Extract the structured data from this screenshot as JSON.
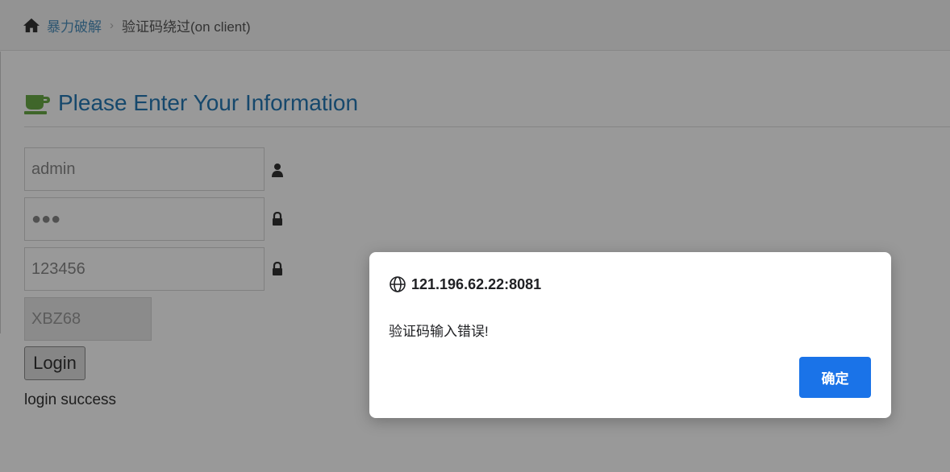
{
  "breadcrumb": {
    "home_icon": "home-icon",
    "parent": "暴力破解",
    "separator": "›",
    "current": "验证码绕过(on client)"
  },
  "header": {
    "icon": "coffee-icon",
    "title": "Please Enter Your Information"
  },
  "form": {
    "username_value": "admin",
    "username_icon": "user-icon",
    "password_value": "●●●",
    "password_icon": "lock-icon",
    "captcha_input_value": "123456",
    "captcha_input_icon": "lock-icon",
    "captcha_code": "XBZ68",
    "login_label": "Login",
    "status": "login success"
  },
  "dialog": {
    "origin": "121.196.62.22:8081",
    "message": "验证码输入错误!",
    "ok_label": "确定",
    "ok_color": "#1a73e8"
  },
  "colors": {
    "link": "#4c8fbd",
    "title": "#2679b5",
    "overlay": "rgba(0,0,0,0.40)"
  }
}
